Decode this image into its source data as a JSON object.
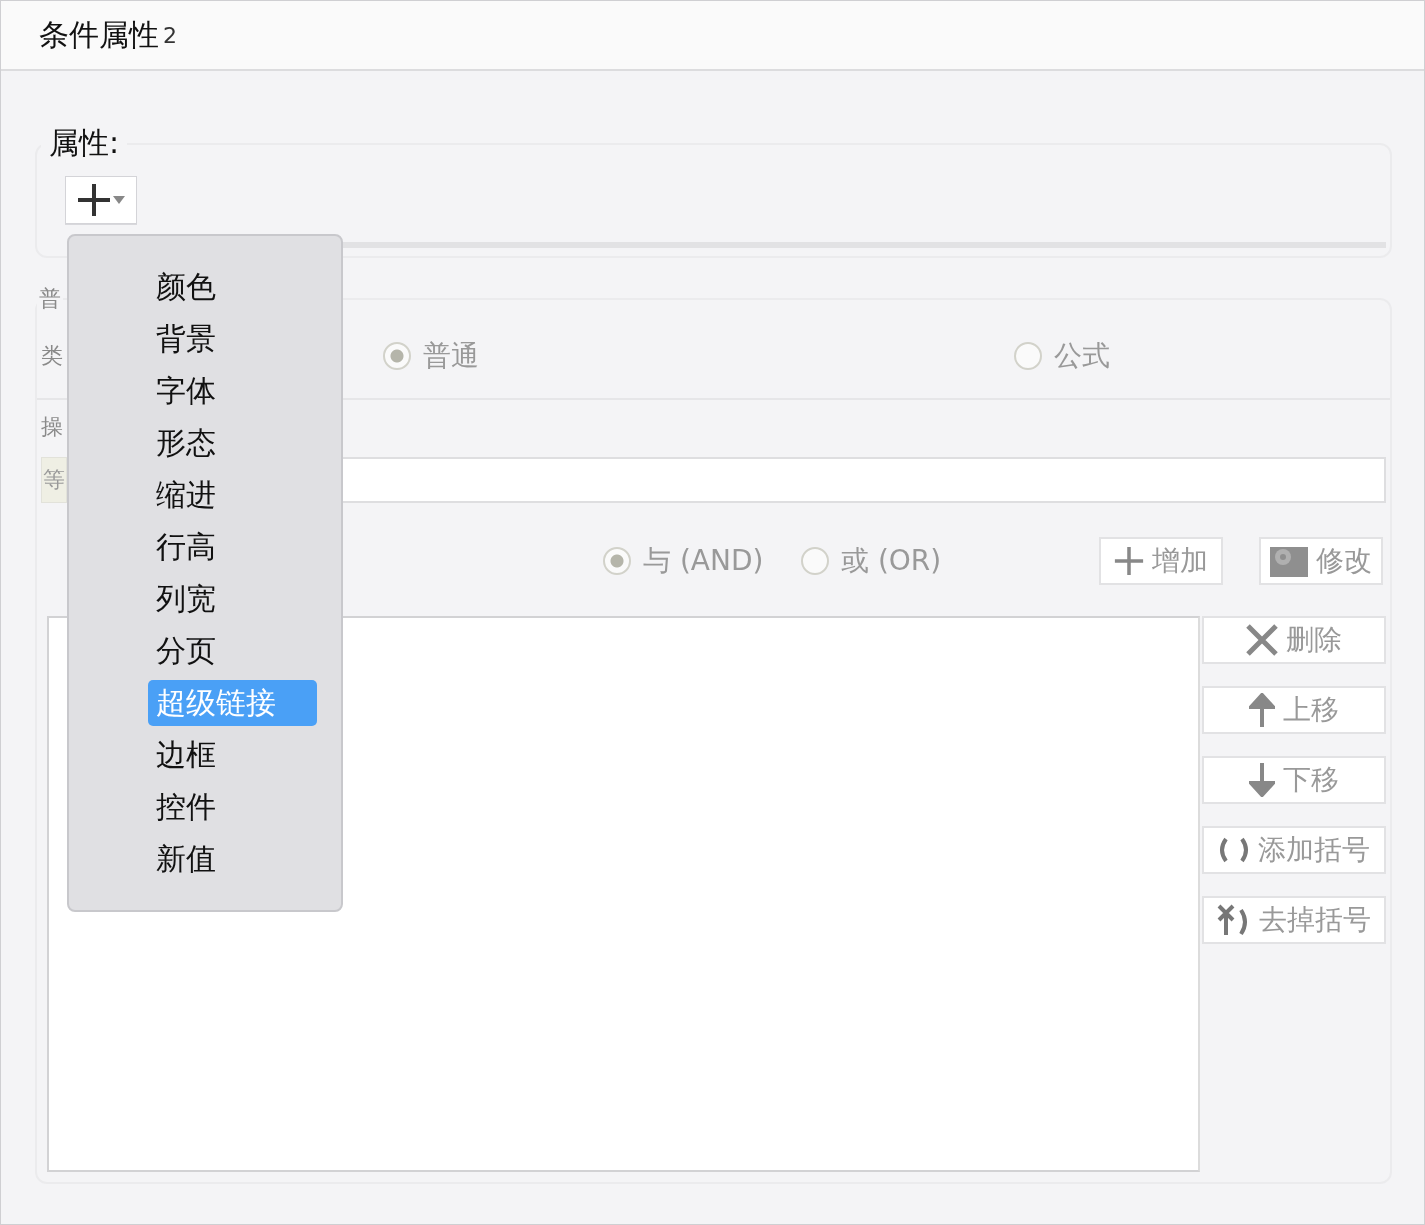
{
  "window": {
    "title": "条件属性",
    "title_suffix": "2"
  },
  "properties": {
    "label": "属性:",
    "menu": {
      "expanded": true,
      "items": [
        {
          "label": "颜色",
          "selected": false
        },
        {
          "label": "背景",
          "selected": false
        },
        {
          "label": "字体",
          "selected": false
        },
        {
          "label": "形态",
          "selected": false
        },
        {
          "label": "缩进",
          "selected": false
        },
        {
          "label": "行高",
          "selected": false
        },
        {
          "label": "列宽",
          "selected": false
        },
        {
          "label": "分页",
          "selected": false
        },
        {
          "label": "超级链接",
          "selected": true
        },
        {
          "label": "边框",
          "selected": false
        },
        {
          "label": "控件",
          "selected": false
        },
        {
          "label": "新值",
          "selected": false
        }
      ]
    }
  },
  "condition": {
    "heading": "普",
    "type_label": "类",
    "type_options": [
      {
        "label": "普通",
        "selected": true
      },
      {
        "label": "公式",
        "selected": false
      }
    ],
    "operator_label": "操",
    "operator_value": "等",
    "logic_options": [
      {
        "label": "与 (AND)",
        "selected": true
      },
      {
        "label": "或 (OR)",
        "selected": false
      }
    ],
    "buttons": [
      {
        "label": "增加",
        "kind": "add"
      },
      {
        "label": "修改",
        "kind": "edit"
      }
    ],
    "side_buttons": [
      {
        "label": "删除",
        "kind": "delete"
      },
      {
        "label": "上移",
        "kind": "up"
      },
      {
        "label": "下移",
        "kind": "down"
      },
      {
        "label": "添加括号",
        "kind": "add_parens"
      },
      {
        "label": "去掉括号",
        "kind": "remove_parens"
      }
    ]
  }
}
